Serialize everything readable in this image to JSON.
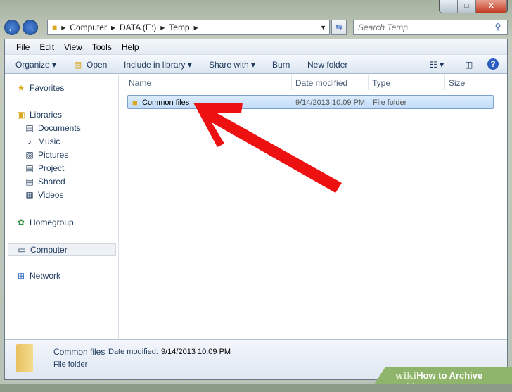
{
  "window": {
    "minimize": "–",
    "maximize": "□",
    "close": "X"
  },
  "nav": {
    "back": "←",
    "forward": "→",
    "breadcrumb": [
      "Computer",
      "DATA (E:)",
      "Temp"
    ],
    "search_placeholder": "Search Temp"
  },
  "menu": [
    "File",
    "Edit",
    "View",
    "Tools",
    "Help"
  ],
  "toolbar": {
    "organize": "Organize ▾",
    "open": "Open",
    "include": "Include in library ▾",
    "share": "Share with ▾",
    "burn": "Burn",
    "new_folder": "New folder"
  },
  "sidebar": {
    "favorites": "Favorites",
    "libraries": "Libraries",
    "library_items": [
      "Documents",
      "Music",
      "Pictures",
      "Project",
      "Shared",
      "Videos"
    ],
    "homegroup": "Homegroup",
    "computer": "Computer",
    "network": "Network"
  },
  "columns": [
    "Name",
    "Date modified",
    "Type",
    "Size"
  ],
  "files": [
    {
      "name": "Common files",
      "date": "9/14/2013 10:09 PM",
      "type": "File folder",
      "size": ""
    }
  ],
  "details": {
    "name": "Common files",
    "date_label": "Date modified:",
    "date": "9/14/2013 10:09 PM",
    "type": "File folder"
  },
  "watermark": {
    "wiki": "wiki",
    "text": "How to Archive Folders"
  },
  "colors": {
    "arrow": "#ee1111",
    "selection": "#cde4fb"
  }
}
